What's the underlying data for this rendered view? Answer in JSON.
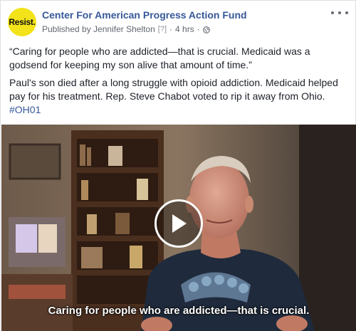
{
  "post": {
    "avatar_text": "Resist.",
    "page_name": "Center For American Progress Action Fund",
    "published_by": "Published by Jennifer Shelton",
    "help_marker": "[?]",
    "time": "4 hrs",
    "separator": "·",
    "quote": "“Caring for people who are addicted—that is crucial. Medicaid was a godsend for keeping my son alive that amount of time.”",
    "paragraph": "Paul's son died after a long struggle with opioid addiction. Medicaid helped pay for his treatment. Rep. Steve Chabot voted to rip it away from Ohio.",
    "hashtag": "#OH01"
  },
  "video": {
    "subtitle": "Caring for people who are addicted—that is crucial."
  },
  "icons": {
    "globe": "globe-icon",
    "more": "more-options-icon",
    "play": "play-icon"
  },
  "colors": {
    "link": "#365899",
    "avatar_bg": "#f2e31a",
    "text": "#1d2129",
    "meta": "#616770"
  }
}
